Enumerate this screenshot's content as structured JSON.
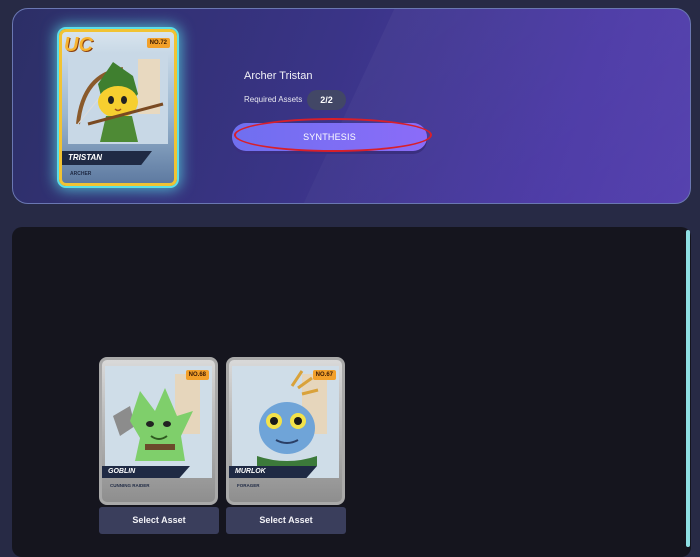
{
  "target": {
    "name": "Archer Tristan",
    "card": {
      "grade": "UC",
      "number": "NO.72",
      "name": "TRISTAN",
      "class": "ARCHER"
    },
    "required_assets_label": "Required Assets",
    "required_assets_count": "2/2",
    "synthesis_label": "SYNTHESIS"
  },
  "assets": [
    {
      "name": "GOBLIN",
      "class": "CUNNING RAIDER",
      "number": "NO.68",
      "button_label": "Select Asset"
    },
    {
      "name": "MURLOK",
      "class": "FORAGER",
      "number": "NO.67",
      "button_label": "Select Asset"
    }
  ],
  "colors": {
    "highlight": "#d81f2a",
    "synthesis_button": "#7b6ef4",
    "card_glow": "#5fe0e8",
    "card_gold_border": "#f1c333"
  }
}
